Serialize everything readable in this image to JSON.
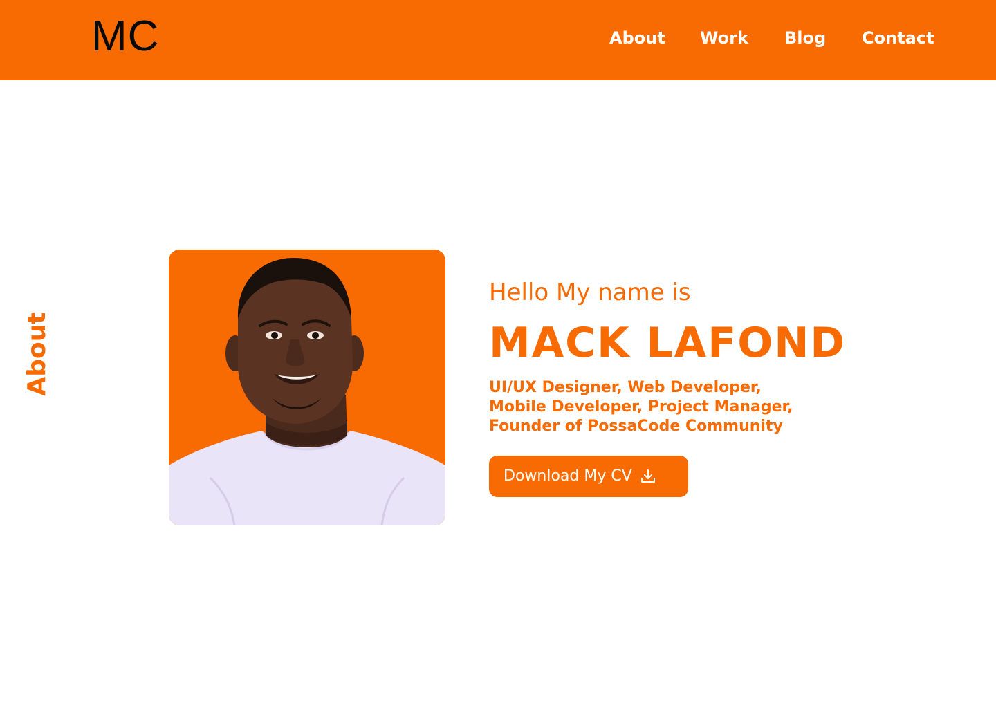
{
  "header": {
    "logo": "MC",
    "nav": [
      {
        "label": "About"
      },
      {
        "label": "Work"
      },
      {
        "label": "Blog"
      },
      {
        "label": "Contact"
      }
    ]
  },
  "side_label": "About",
  "hero": {
    "greeting": "Hello My name is",
    "name": "MACK LAFOND",
    "roles": "UI/UX Designer, Web Developer, Mobile Developer, Project Manager, Founder of PossaCode Community",
    "cta": {
      "label": "Download My CV",
      "icon": "download-icon"
    },
    "photo": {
      "kind": "portrait",
      "background": "#f86b02"
    }
  },
  "colors": {
    "accent": "#f86b02",
    "text_dark": "#0a0a0a",
    "background": "#ffffff"
  }
}
